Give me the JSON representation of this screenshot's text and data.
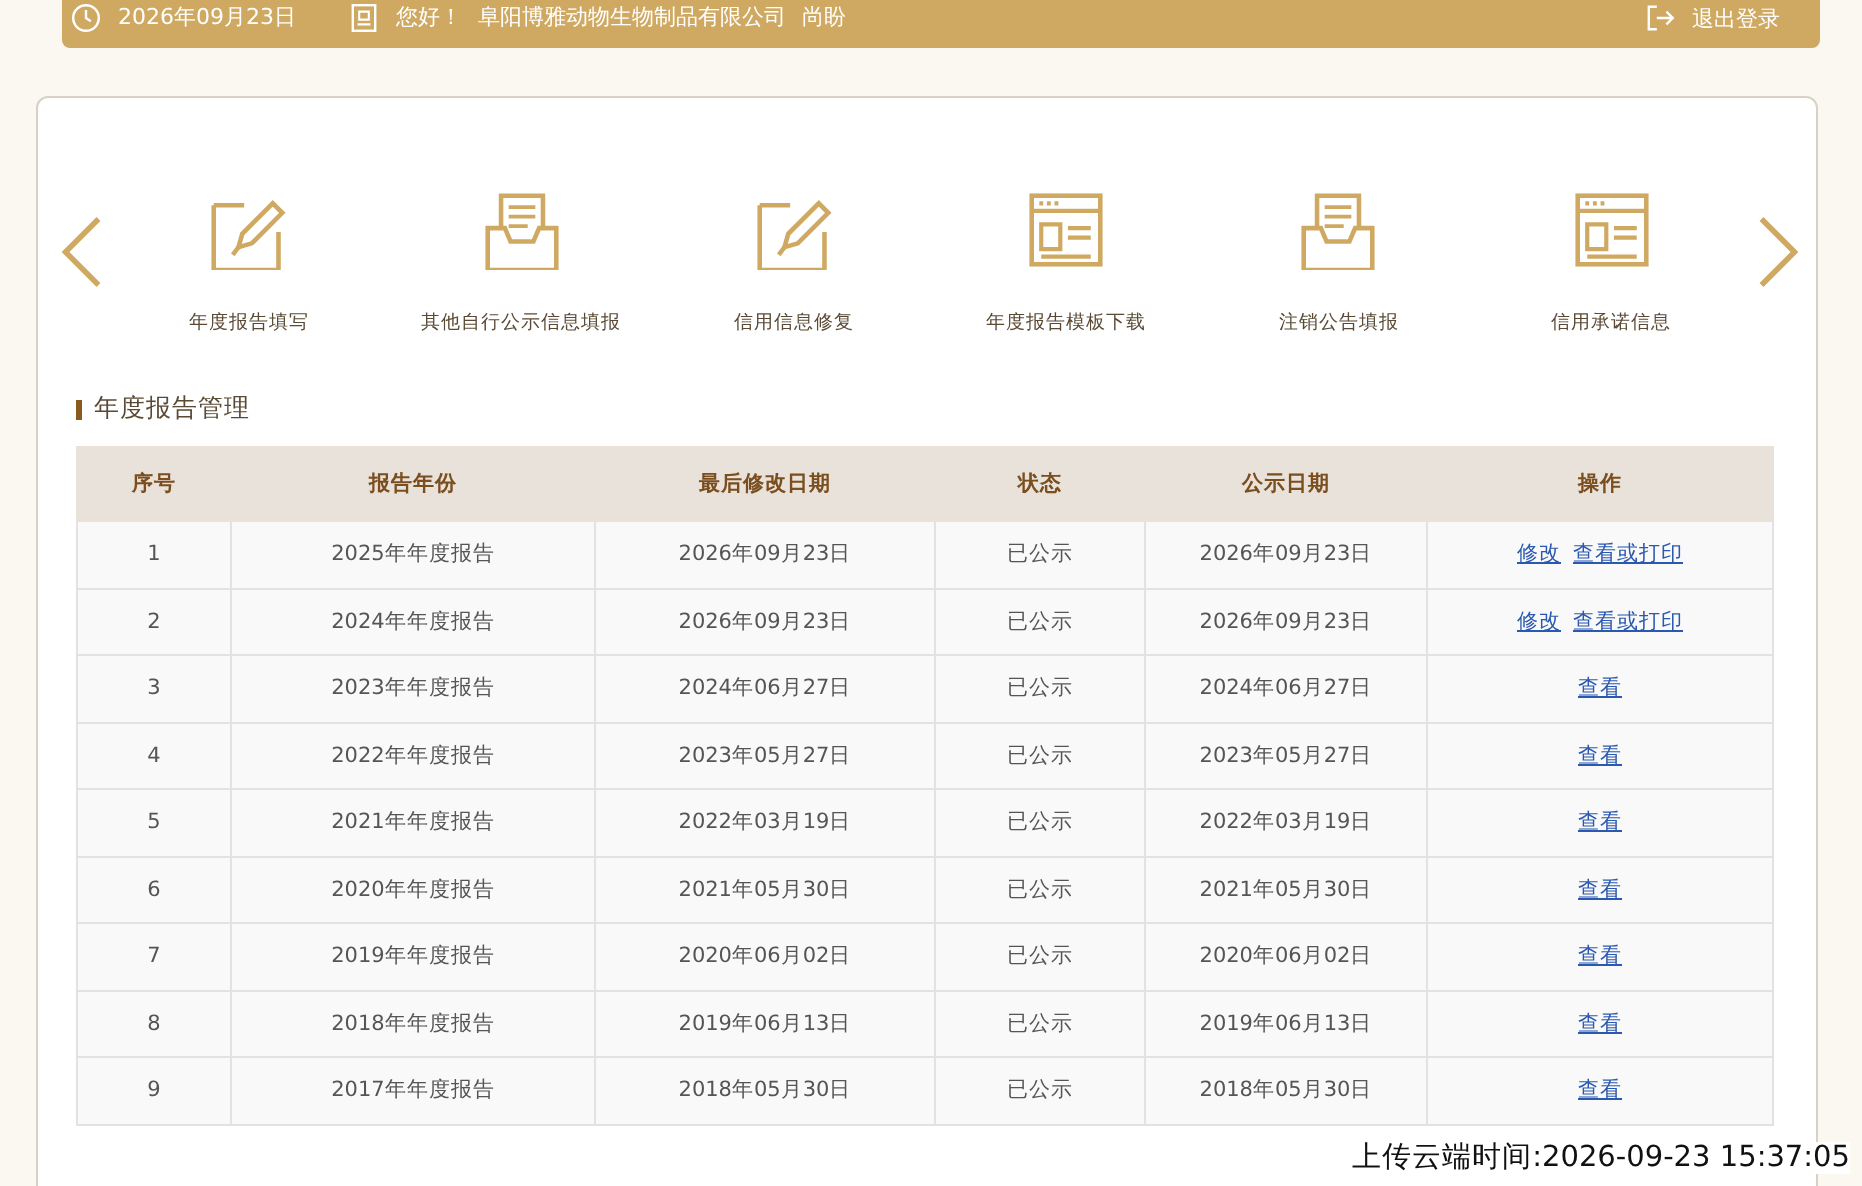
{
  "header": {
    "date": "2026年09月23日",
    "greeting": "您好！",
    "company": "阜阳博雅动物生物制品有限公司",
    "user": "尚盼",
    "logout": "退出登录"
  },
  "shortcuts": [
    {
      "label": "年度报告填写",
      "kind": "edit"
    },
    {
      "label": "其他自行公示信息填报",
      "kind": "tray"
    },
    {
      "label": "信用信息修复",
      "kind": "edit"
    },
    {
      "label": "年度报告模板下载",
      "kind": "window"
    },
    {
      "label": "注销公告填报",
      "kind": "tray"
    },
    {
      "label": "信用承诺信息",
      "kind": "window"
    }
  ],
  "section_title": "年度报告管理",
  "table": {
    "columns": [
      "序号",
      "报告年份",
      "最后修改日期",
      "状态",
      "公示日期",
      "操作"
    ],
    "rows": [
      {
        "no": "1",
        "year": "2025年年度报告",
        "modified": "2026年09月23日",
        "status": "已公示",
        "published": "2026年09月23日",
        "actions": [
          "修改",
          "查看或打印"
        ]
      },
      {
        "no": "2",
        "year": "2024年年度报告",
        "modified": "2026年09月23日",
        "status": "已公示",
        "published": "2026年09月23日",
        "actions": [
          "修改",
          "查看或打印"
        ]
      },
      {
        "no": "3",
        "year": "2023年年度报告",
        "modified": "2024年06月27日",
        "status": "已公示",
        "published": "2024年06月27日",
        "actions": [
          "查看"
        ]
      },
      {
        "no": "4",
        "year": "2022年年度报告",
        "modified": "2023年05月27日",
        "status": "已公示",
        "published": "2023年05月27日",
        "actions": [
          "查看"
        ]
      },
      {
        "no": "5",
        "year": "2021年年度报告",
        "modified": "2022年03月19日",
        "status": "已公示",
        "published": "2022年03月19日",
        "actions": [
          "查看"
        ]
      },
      {
        "no": "6",
        "year": "2020年年度报告",
        "modified": "2021年05月30日",
        "status": "已公示",
        "published": "2021年05月30日",
        "actions": [
          "查看"
        ]
      },
      {
        "no": "7",
        "year": "2019年年度报告",
        "modified": "2020年06月02日",
        "status": "已公示",
        "published": "2020年06月02日",
        "actions": [
          "查看"
        ]
      },
      {
        "no": "8",
        "year": "2018年年度报告",
        "modified": "2019年06月13日",
        "status": "已公示",
        "published": "2019年06月13日",
        "actions": [
          "查看"
        ]
      },
      {
        "no": "9",
        "year": "2017年年度报告",
        "modified": "2018年05月30日",
        "status": "已公示",
        "published": "2018年05月30日",
        "actions": [
          "查看"
        ]
      }
    ]
  },
  "upload_time": "上传云端时间:2026-09-23 15:37:05"
}
